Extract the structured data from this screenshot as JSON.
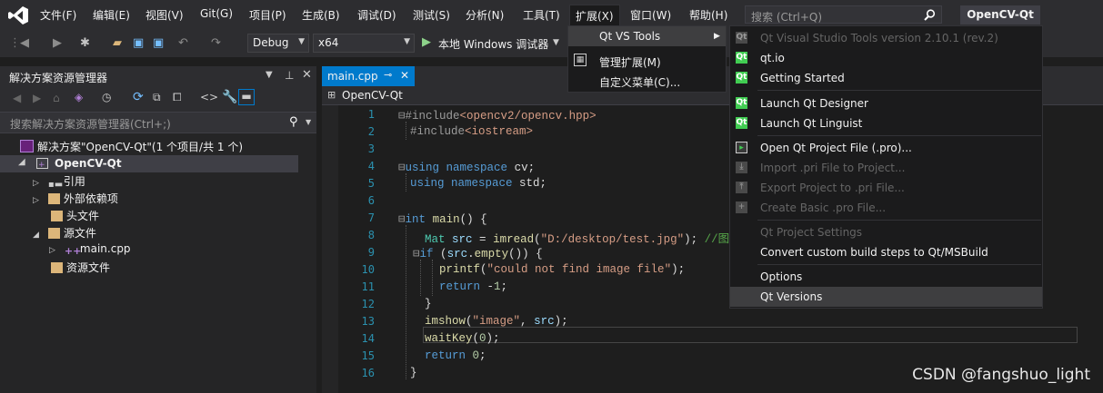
{
  "menubar": {
    "items": [
      "文件(F)",
      "编辑(E)",
      "视图(V)",
      "Git(G)",
      "项目(P)",
      "生成(B)",
      "调试(D)",
      "测试(S)",
      "分析(N)",
      "工具(T)",
      "扩展(X)",
      "窗口(W)",
      "帮助(H)"
    ],
    "search_placeholder": "搜索 (Ctrl+Q)",
    "project_name": "OpenCV-Qt"
  },
  "toolbar": {
    "config": "Debug",
    "platform": "x64",
    "run_label": "本地 Windows 调试器"
  },
  "solution_explorer": {
    "title": "解决方案资源管理器",
    "search_placeholder": "搜索解决方案资源管理器(Ctrl+;)",
    "solution": "解决方案\"OpenCV-Qt\"(1 个项目/共 1 个)",
    "project": "OpenCV-Qt",
    "nodes": [
      "引用",
      "外部依赖项",
      "头文件",
      "源文件",
      "main.cpp",
      "资源文件"
    ]
  },
  "editor": {
    "tab": "main.cpp",
    "nav_scope": "OpenCV-Qt",
    "line_numbers": [
      "1",
      "2",
      "3",
      "4",
      "5",
      "6",
      "7",
      "8",
      "9",
      "10",
      "11",
      "12",
      "13",
      "14",
      "15",
      "16"
    ]
  },
  "ext_menu": {
    "items": [
      "Qt VS Tools",
      "管理扩展(M)",
      "自定义菜单(C)..."
    ]
  },
  "qt_menu": {
    "items": [
      {
        "label": "Qt Visual Studio Tools version 2.10.1 (rev.2)",
        "disabled": true
      },
      {
        "label": "qt.io",
        "disabled": false
      },
      {
        "label": "Getting Started",
        "disabled": false
      },
      {
        "label": "Launch Qt Designer",
        "disabled": false
      },
      {
        "label": "Launch Qt Linguist",
        "disabled": false
      },
      {
        "label": "Open Qt Project File (.pro)...",
        "disabled": false
      },
      {
        "label": "Import .pri File to Project...",
        "disabled": true
      },
      {
        "label": "Export Project to .pri File...",
        "disabled": true
      },
      {
        "label": "Create Basic .pro File...",
        "disabled": true
      },
      {
        "label": "Qt Project Settings",
        "disabled": true
      },
      {
        "label": "Convert custom build steps to Qt/MSBuild",
        "disabled": false
      },
      {
        "label": "Options",
        "disabled": false
      },
      {
        "label": "Qt Versions",
        "disabled": false
      }
    ]
  },
  "watermark": "CSDN @fangshuo_light",
  "colors": {
    "accent": "#007acc",
    "qt_green": "#41cd52",
    "menu_bg": "#1b1b1c"
  }
}
